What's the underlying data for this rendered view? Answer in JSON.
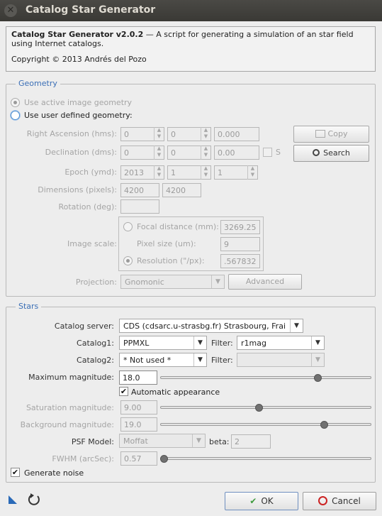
{
  "window": {
    "title": "Catalog Star Generator",
    "close_glyph": "✕"
  },
  "info": {
    "name": "Catalog Star Generator v2.0.2",
    "description": " — A script for generating a simulation of an star field using Internet catalogs.",
    "copyright": "Copyright © 2013 Andrés del Pozo"
  },
  "geometry": {
    "title": "Geometry",
    "use_active": "Use active image geometry",
    "use_user": "Use user defined geometry:",
    "ra_label": "Right Ascension (hms):",
    "ra": [
      "0",
      "0",
      "0.000"
    ],
    "dec_label": "Declination (dms):",
    "dec": [
      "0",
      "0",
      "0.00"
    ],
    "dec_s_label": "S",
    "epoch_label": "Epoch (ymd):",
    "epoch": [
      "2013",
      "1",
      "1"
    ],
    "dims_label": "Dimensions (pixels):",
    "dims": [
      "4200",
      "4200"
    ],
    "rotation_label": "Rotation (deg):",
    "rotation": "",
    "copy_label": "Copy",
    "search_label": "Search",
    "scale_label": "Image scale:",
    "focal_label": "Focal distance (mm):",
    "focal": "3269.25",
    "pixel_label": "Pixel size (um):",
    "pixel": "9",
    "resolution_label": "Resolution (\"/px):",
    "resolution": ".567832",
    "projection_label": "Projection:",
    "projection": "Gnomonic",
    "advanced_label": "Advanced"
  },
  "stars": {
    "title": "Stars",
    "server_label": "Catalog server:",
    "server": "CDS (cdsarc.u-strasbg.fr) Strasbourg, Frai",
    "catalog1_label": "Catalog1:",
    "catalog1": "PPMXL",
    "filter_label": "Filter:",
    "filter1": "r1mag",
    "catalog2_label": "Catalog2:",
    "catalog2": "* Not used *",
    "filter2": "",
    "max_mag_label": "Maximum magnitude:",
    "max_mag": "18.0",
    "max_mag_level": 0.76,
    "auto_label": "Automatic appearance",
    "auto_checked": true,
    "sat_label": "Saturation magnitude:",
    "sat": "9.00",
    "sat_level": 0.47,
    "bg_label": "Background magnitude:",
    "bg": "19.0",
    "bg_level": 0.79,
    "psf_label": "PSF Model:",
    "psf": "Moffat",
    "beta_label": "beta:",
    "beta": "2",
    "fwhm_label": "FWHM (arcSec):",
    "fwhm": "0.57",
    "fwhm_level": 0.0,
    "noise_label": "Generate noise",
    "noise_checked": true
  },
  "footer": {
    "ok_label": "OK",
    "cancel_label": "Cancel"
  },
  "colors": {
    "accent": "#3b6fb6",
    "title_bg": "#3c3b37",
    "ok_icon": "#3e9b3e",
    "cancel_icon": "#cc2222"
  }
}
